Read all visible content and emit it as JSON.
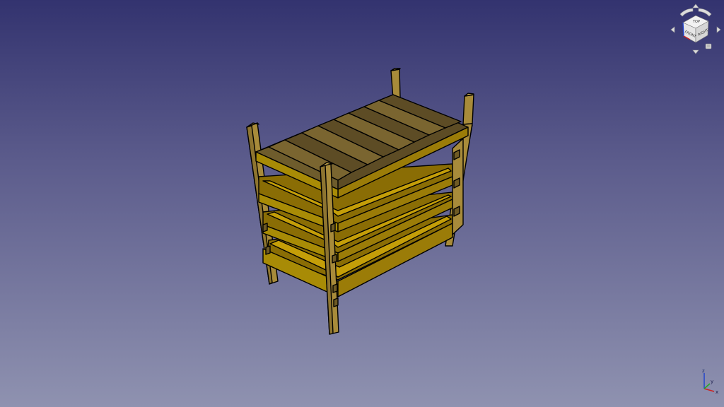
{
  "viewport": {
    "background_top": "#33336f",
    "background_bottom": "#8f92b0"
  },
  "model": {
    "name": "",
    "leg_color": "#a88b3a",
    "shelf_color": "#8a6d05",
    "slat_dark": "#5d4c25",
    "slat_light": "#7a6530",
    "edge_color": "#000000"
  },
  "navcube": {
    "faces": {
      "top": "TOP",
      "front": "FRONT",
      "right": "RIGHT"
    },
    "icons": [
      "rotate-left-icon",
      "rotate-right-icon",
      "arrow-up-icon",
      "arrow-down-icon",
      "arrow-left-icon",
      "arrow-right-icon",
      "view-menu-icon"
    ]
  },
  "axis_cross": {
    "x_label": "x",
    "y_label": "y",
    "z_label": "z",
    "x_color": "#cc2222",
    "y_color": "#22aa22",
    "z_color": "#2244cc"
  }
}
